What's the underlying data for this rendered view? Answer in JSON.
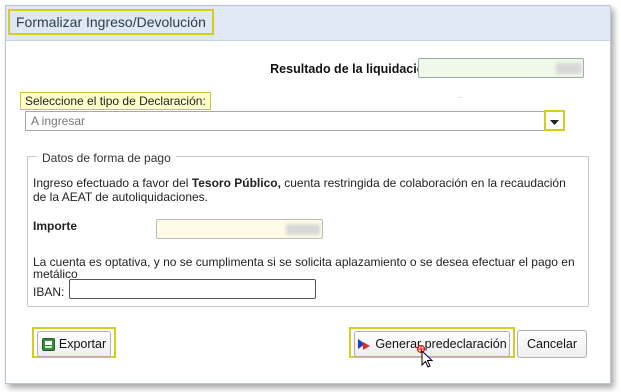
{
  "dialog": {
    "title": "Formalizar Ingreso/Devolución"
  },
  "resultado": {
    "label": "Resultado de la liquidación"
  },
  "tipo": {
    "tooltip": "Seleccione el tipo de Declaración:",
    "selected": "A ingresar"
  },
  "pago": {
    "legend": "Datos de forma de pago",
    "info_prefix": "Ingreso efectuado a favor del ",
    "info_bold": "Tesoro Público,",
    "info_suffix": " cuenta restringida de colaboración en la recaudación de la AEAT de autoliquidaciones.",
    "importe_label": "Importe",
    "note": "La cuenta es optativa, y no se cumplimenta si se solicita aplazamiento o se desea efectuar el pago en metálico",
    "iban_label": "IBAN:"
  },
  "buttons": {
    "exportar": "Exportar",
    "generar": "Generar predeclaración",
    "cancelar": "Cancelar"
  },
  "colors": {
    "highlight": "#d4cf1d",
    "titlebar": "#dfe8f4"
  },
  "icons": {
    "exportar": "export-icon",
    "generar": "generate-icon",
    "select": "chevron-down-icon"
  }
}
